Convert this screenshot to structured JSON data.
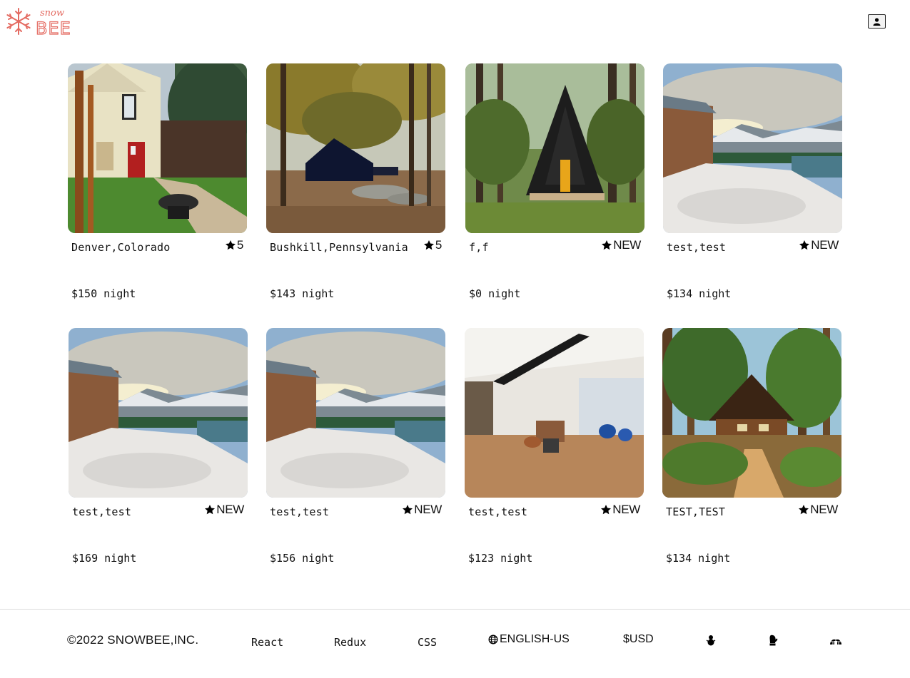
{
  "header": {
    "logo_top": "snow",
    "logo_bottom": "BEE",
    "profile_icon": "user-icon"
  },
  "colors": {
    "brand": "#e46b62"
  },
  "listings": [
    {
      "location": "Denver,Colorado",
      "rating": "5",
      "price": "$150 night",
      "image": "yellow-house-firepit"
    },
    {
      "location": "Bushkill,Pennsylvania",
      "rating": "5",
      "price": "$143 night",
      "image": "dark-cabin-autumn-woods"
    },
    {
      "location": "f,f",
      "rating": "NEW",
      "price": "$0 night",
      "image": "a-frame-cabin-forest"
    },
    {
      "location": "test,test",
      "rating": "NEW",
      "price": "$134 night",
      "image": "snowy-lakeside-cabin"
    },
    {
      "location": "test,test",
      "rating": "NEW",
      "price": "$169 night",
      "image": "snowy-lakeside-cabin"
    },
    {
      "location": "test,test",
      "rating": "NEW",
      "price": "$156 night",
      "image": "snowy-lakeside-cabin"
    },
    {
      "location": "test,test",
      "rating": "NEW",
      "price": "$123 night",
      "image": "modern-lobby-interior"
    },
    {
      "location": "TEST,TEST",
      "rating": "NEW",
      "price": "$134 night",
      "image": "log-cabin-forest"
    }
  ],
  "footer": {
    "copyright": "©2022 SNOWBEE,INC.",
    "links": [
      "React",
      "Redux",
      "CSS"
    ],
    "language": "ENGLISH-US",
    "currency": "$USD",
    "icons": [
      "snowman-icon",
      "mitten-icon",
      "igloo-icon"
    ]
  }
}
